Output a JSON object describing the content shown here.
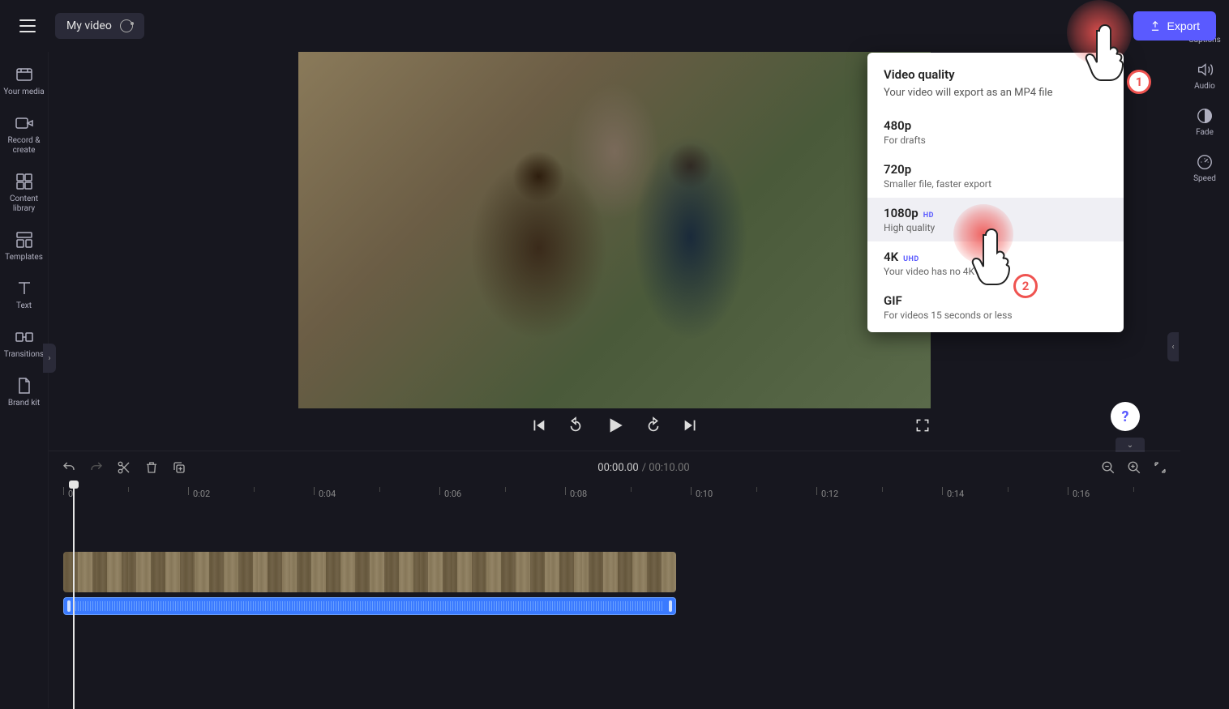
{
  "header": {
    "project_title": "My video",
    "export_label": "Export"
  },
  "left_sidebar": {
    "items": [
      {
        "label": "Your media",
        "icon": "media"
      },
      {
        "label": "Record & create",
        "icon": "record"
      },
      {
        "label": "Content library",
        "icon": "library"
      },
      {
        "label": "Templates",
        "icon": "templates"
      },
      {
        "label": "Text",
        "icon": "text"
      },
      {
        "label": "Transitions",
        "icon": "transitions"
      },
      {
        "label": "Brand kit",
        "icon": "brand"
      }
    ]
  },
  "right_sidebar": {
    "items": [
      {
        "label": "Captions",
        "icon": "captions"
      },
      {
        "label": "Audio",
        "icon": "audio"
      },
      {
        "label": "Fade",
        "icon": "fade"
      },
      {
        "label": "Speed",
        "icon": "speed"
      }
    ]
  },
  "export_popup": {
    "title": "Video quality",
    "subtitle": "Your video will export as an MP4 file",
    "options": [
      {
        "label": "480p",
        "badge": "",
        "desc": "For drafts"
      },
      {
        "label": "720p",
        "badge": "",
        "desc": "Smaller file, faster export"
      },
      {
        "label": "1080p",
        "badge": "HD",
        "desc": "High quality"
      },
      {
        "label": "4K",
        "badge": "UHD",
        "desc": "Your video has no 4K"
      },
      {
        "label": "GIF",
        "badge": "",
        "desc": "For videos 15 seconds or less"
      }
    ]
  },
  "timeline": {
    "current_time": "00:00.00",
    "total_time": "00:10.00",
    "ruler_start": "0",
    "ticks": [
      "0:02",
      "0:04",
      "0:06",
      "0:08",
      "0:10",
      "0:12",
      "0:14",
      "0:16"
    ]
  },
  "annotations": {
    "step1": "1",
    "step2": "2"
  },
  "help": "?"
}
